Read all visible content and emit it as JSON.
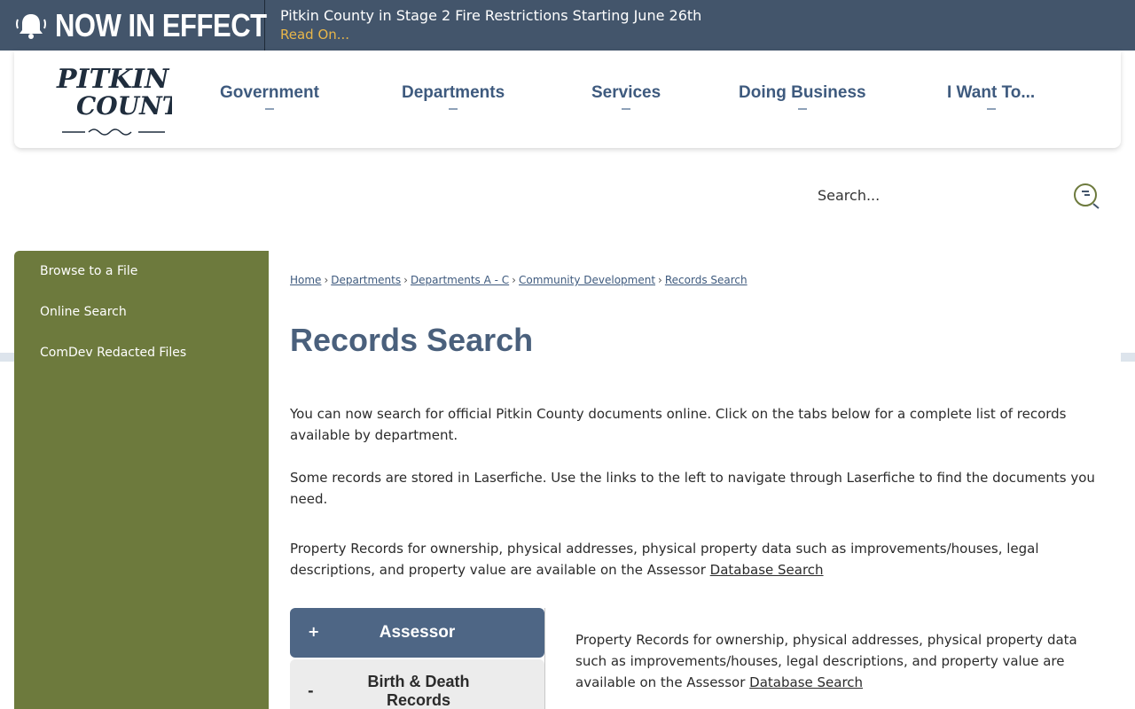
{
  "alert": {
    "label": "NOW IN EFFECT",
    "title": "Pitkin County in Stage 2 Fire Restrictions Starting June 26th",
    "link": "Read On..."
  },
  "header": {
    "logo_text_1": "PITKIN",
    "logo_text_2": "COUNTY",
    "nav": [
      "Government",
      "Departments",
      "Services",
      "Doing Business",
      "I Want To..."
    ]
  },
  "search": {
    "placeholder": "Search..."
  },
  "sidebar": {
    "items": [
      "Browse to a File",
      "Online Search",
      "ComDev Redacted Files"
    ]
  },
  "breadcrumb": [
    "Home",
    "Departments",
    "Departments A - C",
    "Community Development",
    "Records Search"
  ],
  "page": {
    "title": "Records Search",
    "para1": "You can now search for official Pitkin County documents online.  Click on the tabs below for a complete list of records available by department.",
    "para2": "Some records are stored in Laserfiche.  Use the links to the left to navigate through Laserfiche to find the documents you need.",
    "para3_text": "Property Records for ownership, physical addresses, physical property data such as improvements/houses, legal descriptions, and property value are available on the Assessor ",
    "para3_link": "Database Search"
  },
  "tabs": {
    "active": {
      "sign": "+",
      "label": "Assessor"
    },
    "inactive": {
      "sign": "-",
      "label": "Birth & Death Records"
    },
    "panel_text": "Property Records for ownership, physical addresses, physical property data such as improvements/houses, legal descriptions, and property value are available on the Assessor ",
    "panel_link": "Database Search"
  },
  "colors": {
    "alert_bg": "#43556b",
    "alert_link": "#e8b64a",
    "nav_text": "#3e5a7e",
    "sidebar_bg": "#6d7a3d",
    "title": "#4a607c",
    "tab_active_bg": "#4e6685"
  }
}
